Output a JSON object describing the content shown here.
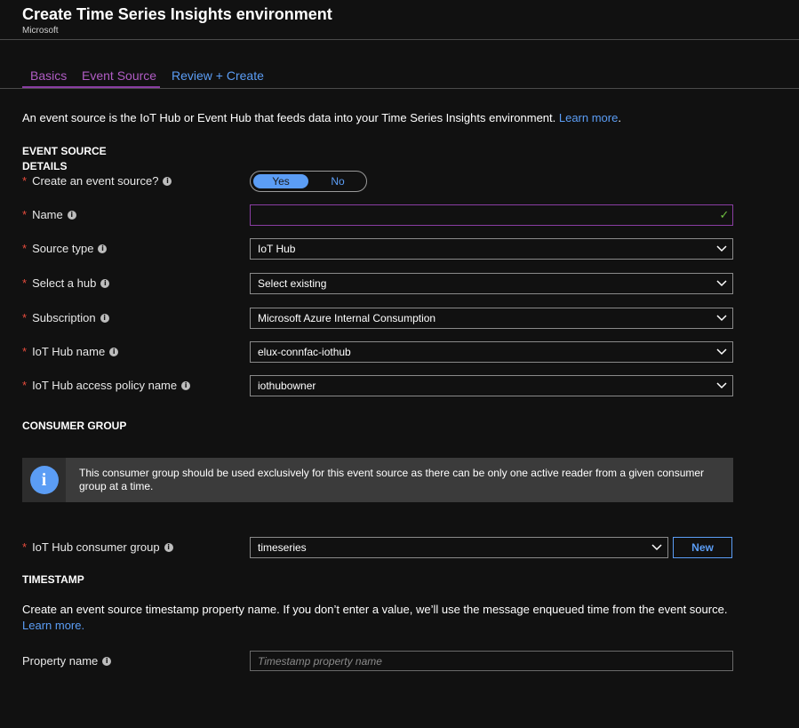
{
  "header": {
    "title": "Create Time Series Insights environment",
    "publisher": "Microsoft"
  },
  "tabs": [
    {
      "label": "Basics",
      "color": "#b05cc4"
    },
    {
      "label": "Event Source",
      "color": "#b05cc4",
      "active": true
    },
    {
      "label": "Review + Create",
      "color": "#5b9df5"
    }
  ],
  "intro": {
    "text": "An event source is the IoT Hub or Event Hub that feeds data into your Time Series Insights environment. ",
    "link": "Learn more",
    "after": "."
  },
  "event_source": {
    "heading_line1": "EVENT SOURCE",
    "heading_line2": "DETAILS",
    "create_label": "Create an event source?",
    "toggle_yes": "Yes",
    "toggle_no": "No",
    "name_label": "Name",
    "name_value": "",
    "source_type_label": "Source type",
    "source_type_value": "IoT Hub",
    "select_hub_label": "Select a hub",
    "select_hub_value": "Select existing",
    "subscription_label": "Subscription",
    "subscription_value": "Microsoft Azure Internal Consumption",
    "iothub_name_label": "IoT Hub name",
    "iothub_name_value": "elux-connfac-iothub",
    "policy_label": "IoT Hub access policy name",
    "policy_value": "iothubowner"
  },
  "consumer_group": {
    "heading": "CONSUMER GROUP",
    "info_text": "This consumer group should be used exclusively for this event source as there can be only one active reader from a given consumer group at a time.",
    "label": "IoT Hub consumer group",
    "value": "timeseries",
    "new_button": "New"
  },
  "timestamp": {
    "heading": "TIMESTAMP",
    "desc": "Create an event source timestamp property name. If you don’t enter a value, we’ll use the message enqueued time from the event source.",
    "link": "Learn more.",
    "property_label": "Property name",
    "property_placeholder": "Timestamp property name"
  },
  "colors": {
    "accent_purple": "#8a3ea3",
    "link_blue": "#5b9df5",
    "required_red": "#e84c3d",
    "check_green": "#6fc041"
  }
}
